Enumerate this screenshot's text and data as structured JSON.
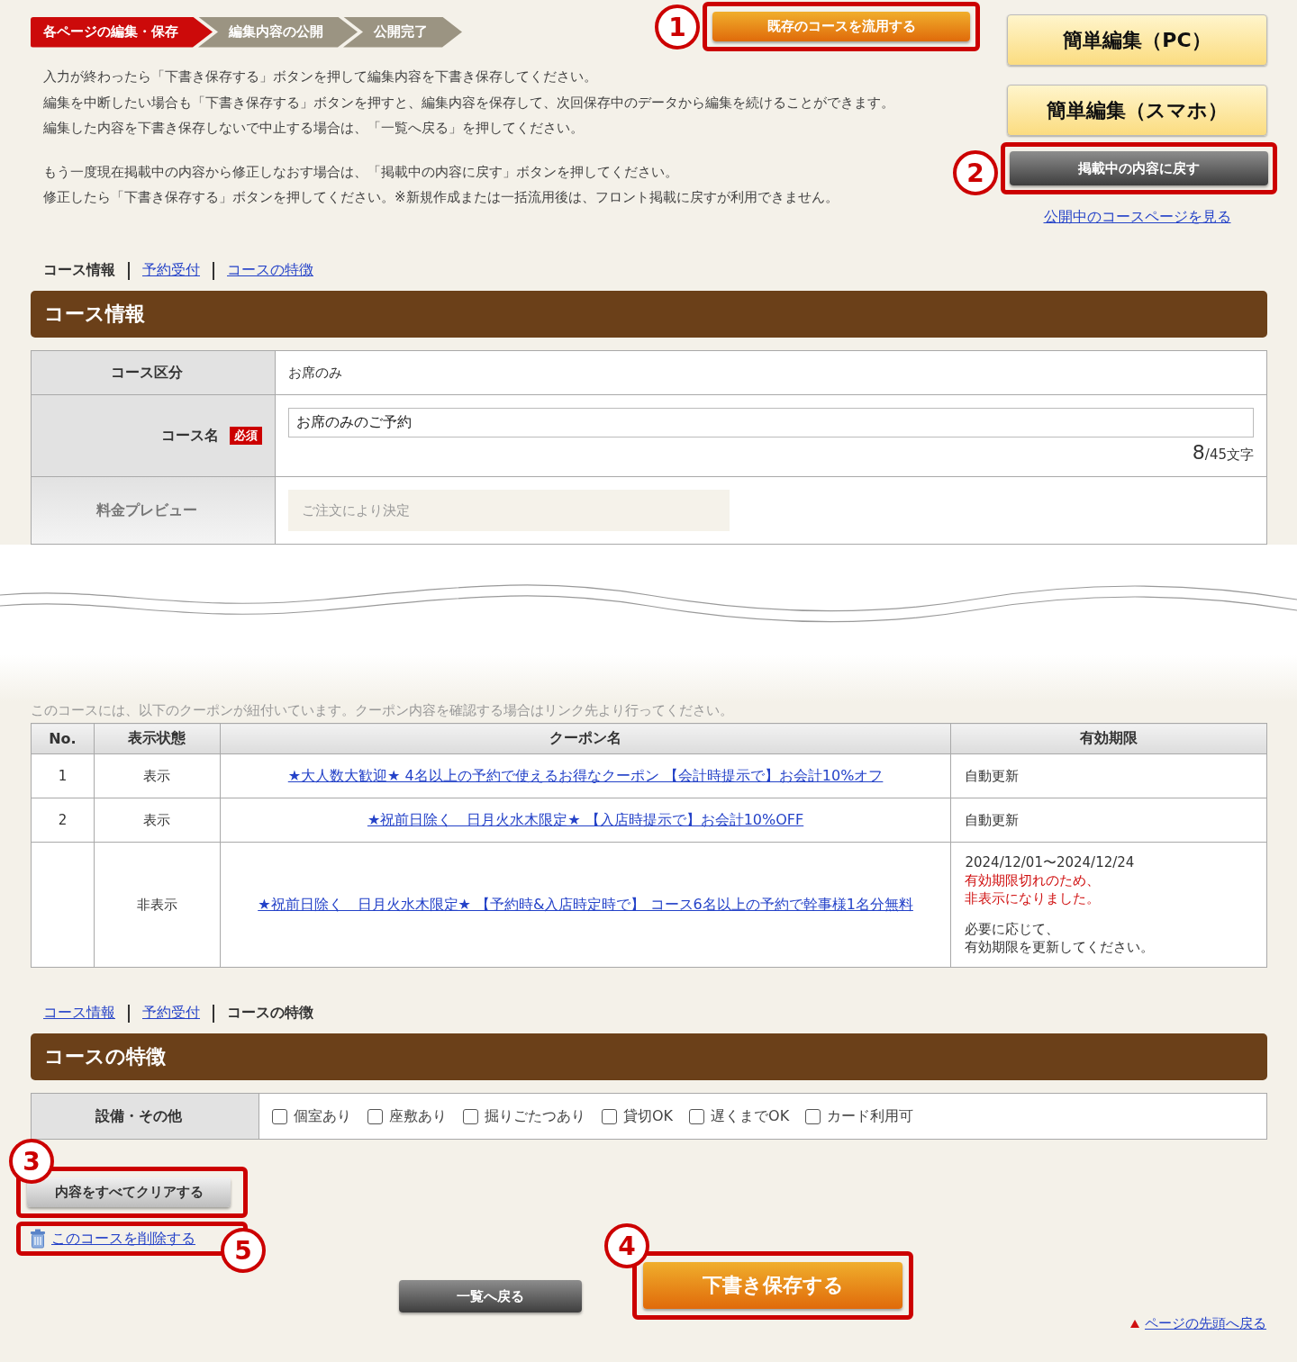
{
  "steps": [
    {
      "label": "各ページの編集・保存",
      "selected": true
    },
    {
      "label": "編集内容の公開",
      "selected": false
    },
    {
      "label": "公開完了",
      "selected": false
    }
  ],
  "copy_course_button": {
    "label": "既存のコースを流用する",
    "callout": "1"
  },
  "intro": [
    [
      "入力が終わったら「下書き保存する」ボタンを押して編集内容を下書き保存してください。",
      "編集を中断したい場合も「下書き保存する」ボタンを押すと、編集内容を保存して、次回保存中のデータから編集を続けることができます。",
      "編集した内容を下書き保存しないで中止する場合は、「一覧へ戻る」を押してください。"
    ],
    [
      "もう一度現在掲載中の内容から修正しなおす場合は、「掲載中の内容に戻す」ボタンを押してください。",
      "修正したら「下書き保存する」ボタンを押してください。※新規作成または一括流用後は、フロント掲載に戻すが利用できません。"
    ]
  ],
  "easy_edit_buttons": [
    "簡単編集（PC）",
    "簡単編集（スマホ）"
  ],
  "revert_button": {
    "label": "掲載中の内容に戻す",
    "callout": "2"
  },
  "public_page_link": "公開中のコースページを見る",
  "course_info": {
    "nav": [
      {
        "label": "コース情報",
        "selected": true
      },
      {
        "label": "予約受付",
        "selected": false
      },
      {
        "label": "コースの特徴",
        "selected": false
      }
    ],
    "title": "コース情報",
    "rows": [
      {
        "kind": "text",
        "label": "コース区分",
        "value": "お席のみ"
      },
      {
        "kind": "input",
        "label": "コース名",
        "required": "必須",
        "value": "お席のみのご予約",
        "count": "8",
        "limit": "/45文字"
      },
      {
        "kind": "preview",
        "label": "料金プレビュー",
        "placeholder": "ご注文により決定"
      }
    ]
  },
  "coupons": {
    "note": "このコースには、以下のクーポンが紐付いています。クーポン内容を確認する場合はリンク先より行ってください。",
    "columns": [
      "No.",
      "表示状態",
      "クーポン名",
      "有効期限"
    ],
    "rows": [
      {
        "no": "1",
        "status": "表示",
        "name": "★大人数大歓迎★ 4名以上の予約で使えるお得なクーポン 【会計時提示で】お会計10%オフ",
        "expiry": [
          {
            "kind": "plain",
            "text": "自動更新"
          }
        ]
      },
      {
        "no": "2",
        "status": "表示",
        "name": "★祝前日除く　日月火水木限定★ 【入店時提示で】お会計10%OFF",
        "expiry": [
          {
            "kind": "plain",
            "text": "自動更新"
          }
        ]
      },
      {
        "status": "非表示",
        "name": "★祝前日除く　日月火水木限定★ 【予約時&入店時定時で】 コース6名以上の予約で幹事様1名分無料",
        "expiry": [
          {
            "kind": "plain",
            "text": "2024/12/01〜2024/12/24"
          },
          {
            "kind": "warning",
            "text": "有効期限切れのため、"
          },
          {
            "kind": "warning",
            "text": "非表示になりました。"
          },
          {
            "kind": "note",
            "text": "必要に応じて、"
          },
          {
            "kind": "plain",
            "text": "有効期限を更新してください。"
          }
        ]
      }
    ]
  },
  "features": {
    "nav": [
      {
        "label": "コース情報",
        "selected": false
      },
      {
        "label": "予約受付",
        "selected": false
      },
      {
        "label": "コースの特徴",
        "selected": true
      }
    ],
    "title": "コースの特徴",
    "label": "設備・その他",
    "options": [
      {
        "label": "個室あり",
        "checked": false
      },
      {
        "label": "座敷あり",
        "checked": false
      },
      {
        "label": "掘りごたつあり",
        "checked": false
      },
      {
        "label": "貸切OK",
        "checked": false
      },
      {
        "label": "遅くまでOK",
        "checked": false
      },
      {
        "label": "カード利用可",
        "checked": false
      }
    ]
  },
  "clear_button": {
    "label": "内容をすべてクリアする",
    "callout": "3"
  },
  "delete_link": {
    "label": "このコースを削除する",
    "callout": "5"
  },
  "back_button": "一覧へ戻る",
  "save_button": {
    "label": "下書き保存する",
    "callout": "4"
  },
  "page_top_link": "ページの先頭へ戻る"
}
